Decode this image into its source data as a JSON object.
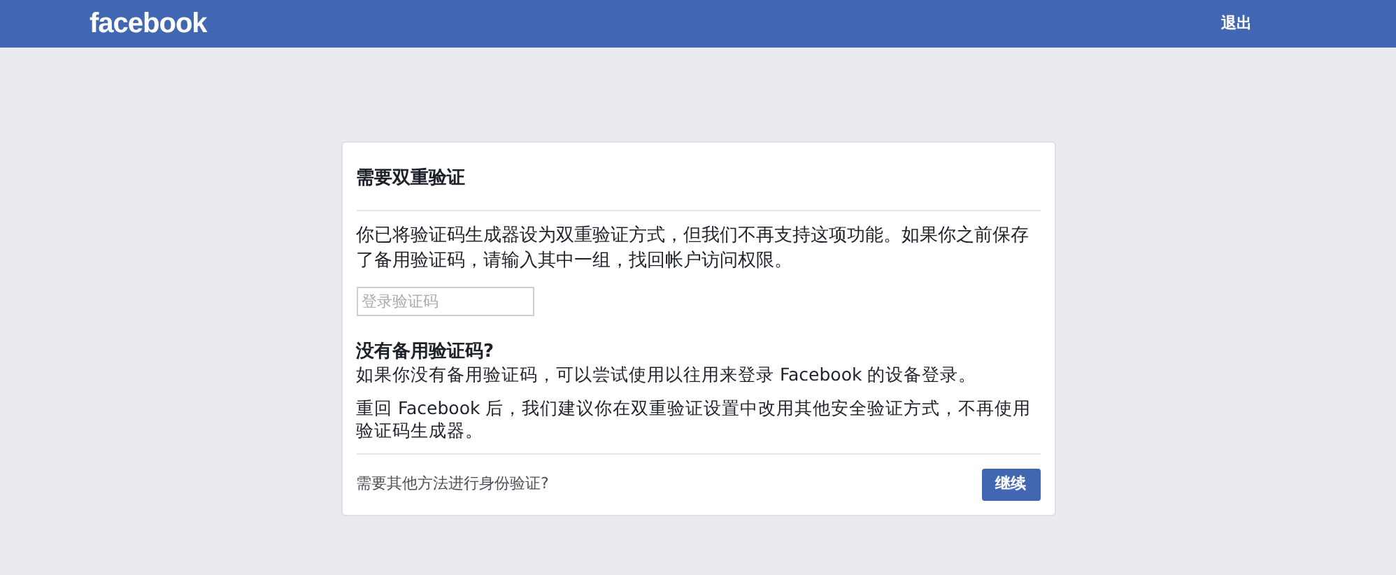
{
  "header": {
    "logo": "facebook",
    "logout": "退出"
  },
  "card": {
    "title": "需要双重验证",
    "intro": "你已将验证码生成器设为双重验证方式，但我们不再支持这项功能。如果你之前保存了备用验证码，请输入其中一组，找回帐户访问权限。",
    "code_field": {
      "placeholder": "登录验证码"
    },
    "subheading": "没有备用验证码?",
    "paragraphs": [
      "如果你没有备用验证码，可以尝试使用以往用来登录 Facebook 的设备登录。",
      "重回 Facebook 后，我们建议你在双重验证设置中改用其他安全验证方式，不再使用验证码生成器。"
    ],
    "other_method_link": "需要其他方法进行身份验证?",
    "continue_button": "继续"
  }
}
